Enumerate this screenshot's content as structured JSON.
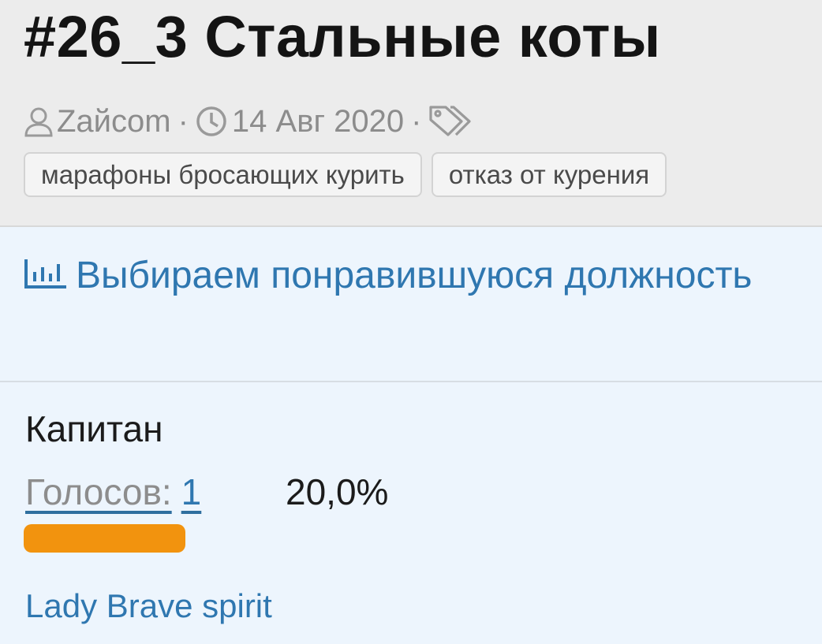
{
  "thread": {
    "title": "#26_3 Стальные коты",
    "author": "Zaйcom",
    "date": "14 Авг 2020",
    "separator": "·",
    "tags": [
      "марафоны бросающих курить",
      "отказ от курения"
    ]
  },
  "poll": {
    "title": "Выбираем понравившуюся должность",
    "options": [
      {
        "label": "Капитан",
        "votes_label": "Голосов:",
        "votes_count": "1",
        "percent_text": "20,0%",
        "share": 0.2,
        "voters": [
          "Lady Brave spirit"
        ]
      }
    ]
  },
  "icons": {
    "author": "user-icon",
    "date": "clock-icon",
    "tags": "tags-icon",
    "poll": "bar-chart-icon"
  },
  "colors": {
    "header_bg": "#ececec",
    "poll_bg": "#edf5fd",
    "link": "#2f77b0",
    "bar": "#f2930e",
    "muted": "#8c8c8c"
  }
}
